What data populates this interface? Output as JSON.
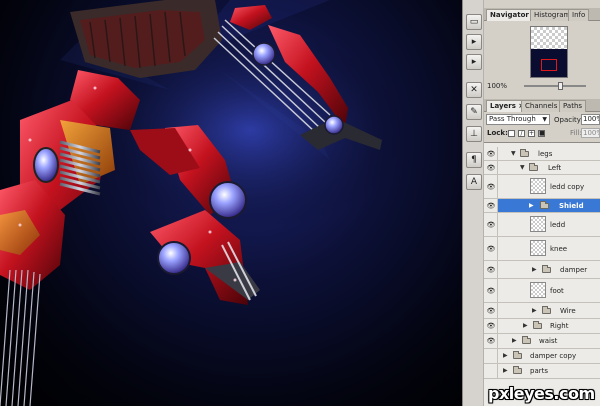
{
  "tool_strip": {
    "icons": [
      "rectangle-icon",
      "arrow-icon",
      "arrow-icon",
      "tools-icon",
      "brush-icon",
      "stamp-icon",
      "paragraph-icon",
      "character-icon"
    ]
  },
  "navigator_panel": {
    "tabs": [
      {
        "label": "Navigator ×",
        "active": true
      },
      {
        "label": "Histogram",
        "active": false
      },
      {
        "label": "Info",
        "active": false
      }
    ],
    "zoom": "100%"
  },
  "layers_panel": {
    "tabs": [
      {
        "label": "Layers ×",
        "active": true
      },
      {
        "label": "Channels",
        "active": false
      },
      {
        "label": "Paths",
        "active": false
      }
    ],
    "blend_mode": "Pass Through",
    "opacity_label": "Opacity:",
    "opacity": "100%",
    "lock_label": "Lock:",
    "fill_label": "Fill:",
    "fill": "100%",
    "layers": [
      {
        "name": "legs",
        "type": "group",
        "expanded": true,
        "visible": true,
        "selected": false
      },
      {
        "name": "Left",
        "type": "group",
        "expanded": true,
        "visible": true,
        "selected": false
      },
      {
        "name": "ledd copy",
        "type": "layer",
        "visible": true,
        "selected": false
      },
      {
        "name": "Shield",
        "type": "group",
        "expanded": false,
        "visible": true,
        "selected": true
      },
      {
        "name": "ledd",
        "type": "layer",
        "visible": true,
        "selected": false
      },
      {
        "name": "knee",
        "type": "layer",
        "visible": true,
        "selected": false
      },
      {
        "name": "damper",
        "type": "group",
        "expanded": false,
        "visible": true,
        "selected": false
      },
      {
        "name": "foot",
        "type": "layer",
        "visible": true,
        "selected": false
      },
      {
        "name": "Wire",
        "type": "group",
        "expanded": false,
        "visible": true,
        "selected": false
      },
      {
        "name": "Right",
        "type": "group",
        "expanded": false,
        "visible": true,
        "selected": false
      },
      {
        "name": "waist",
        "type": "group",
        "expanded": false,
        "visible": true,
        "selected": false
      },
      {
        "name": "damper copy",
        "type": "group",
        "expanded": false,
        "visible": false,
        "selected": false
      },
      {
        "name": "parts",
        "type": "group",
        "expanded": false,
        "visible": false,
        "selected": false
      }
    ]
  },
  "watermark": "pxleyes.com",
  "colors": {
    "selection": "#3a78d6",
    "panel_bg": "#d4d0c8",
    "canvas_bg": "#02030c"
  }
}
